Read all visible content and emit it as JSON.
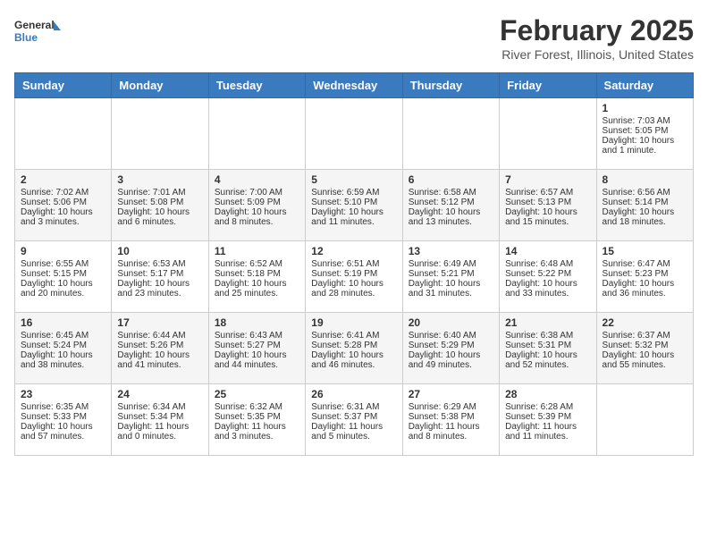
{
  "header": {
    "logo_general": "General",
    "logo_blue": "Blue",
    "month_year": "February 2025",
    "location": "River Forest, Illinois, United States"
  },
  "weekdays": [
    "Sunday",
    "Monday",
    "Tuesday",
    "Wednesday",
    "Thursday",
    "Friday",
    "Saturday"
  ],
  "weeks": [
    [
      {
        "day": "",
        "info": ""
      },
      {
        "day": "",
        "info": ""
      },
      {
        "day": "",
        "info": ""
      },
      {
        "day": "",
        "info": ""
      },
      {
        "day": "",
        "info": ""
      },
      {
        "day": "",
        "info": ""
      },
      {
        "day": "1",
        "info": "Sunrise: 7:03 AM\nSunset: 5:05 PM\nDaylight: 10 hours and 1 minute."
      }
    ],
    [
      {
        "day": "2",
        "info": "Sunrise: 7:02 AM\nSunset: 5:06 PM\nDaylight: 10 hours and 3 minutes."
      },
      {
        "day": "3",
        "info": "Sunrise: 7:01 AM\nSunset: 5:08 PM\nDaylight: 10 hours and 6 minutes."
      },
      {
        "day": "4",
        "info": "Sunrise: 7:00 AM\nSunset: 5:09 PM\nDaylight: 10 hours and 8 minutes."
      },
      {
        "day": "5",
        "info": "Sunrise: 6:59 AM\nSunset: 5:10 PM\nDaylight: 10 hours and 11 minutes."
      },
      {
        "day": "6",
        "info": "Sunrise: 6:58 AM\nSunset: 5:12 PM\nDaylight: 10 hours and 13 minutes."
      },
      {
        "day": "7",
        "info": "Sunrise: 6:57 AM\nSunset: 5:13 PM\nDaylight: 10 hours and 15 minutes."
      },
      {
        "day": "8",
        "info": "Sunrise: 6:56 AM\nSunset: 5:14 PM\nDaylight: 10 hours and 18 minutes."
      }
    ],
    [
      {
        "day": "9",
        "info": "Sunrise: 6:55 AM\nSunset: 5:15 PM\nDaylight: 10 hours and 20 minutes."
      },
      {
        "day": "10",
        "info": "Sunrise: 6:53 AM\nSunset: 5:17 PM\nDaylight: 10 hours and 23 minutes."
      },
      {
        "day": "11",
        "info": "Sunrise: 6:52 AM\nSunset: 5:18 PM\nDaylight: 10 hours and 25 minutes."
      },
      {
        "day": "12",
        "info": "Sunrise: 6:51 AM\nSunset: 5:19 PM\nDaylight: 10 hours and 28 minutes."
      },
      {
        "day": "13",
        "info": "Sunrise: 6:49 AM\nSunset: 5:21 PM\nDaylight: 10 hours and 31 minutes."
      },
      {
        "day": "14",
        "info": "Sunrise: 6:48 AM\nSunset: 5:22 PM\nDaylight: 10 hours and 33 minutes."
      },
      {
        "day": "15",
        "info": "Sunrise: 6:47 AM\nSunset: 5:23 PM\nDaylight: 10 hours and 36 minutes."
      }
    ],
    [
      {
        "day": "16",
        "info": "Sunrise: 6:45 AM\nSunset: 5:24 PM\nDaylight: 10 hours and 38 minutes."
      },
      {
        "day": "17",
        "info": "Sunrise: 6:44 AM\nSunset: 5:26 PM\nDaylight: 10 hours and 41 minutes."
      },
      {
        "day": "18",
        "info": "Sunrise: 6:43 AM\nSunset: 5:27 PM\nDaylight: 10 hours and 44 minutes."
      },
      {
        "day": "19",
        "info": "Sunrise: 6:41 AM\nSunset: 5:28 PM\nDaylight: 10 hours and 46 minutes."
      },
      {
        "day": "20",
        "info": "Sunrise: 6:40 AM\nSunset: 5:29 PM\nDaylight: 10 hours and 49 minutes."
      },
      {
        "day": "21",
        "info": "Sunrise: 6:38 AM\nSunset: 5:31 PM\nDaylight: 10 hours and 52 minutes."
      },
      {
        "day": "22",
        "info": "Sunrise: 6:37 AM\nSunset: 5:32 PM\nDaylight: 10 hours and 55 minutes."
      }
    ],
    [
      {
        "day": "23",
        "info": "Sunrise: 6:35 AM\nSunset: 5:33 PM\nDaylight: 10 hours and 57 minutes."
      },
      {
        "day": "24",
        "info": "Sunrise: 6:34 AM\nSunset: 5:34 PM\nDaylight: 11 hours and 0 minutes."
      },
      {
        "day": "25",
        "info": "Sunrise: 6:32 AM\nSunset: 5:35 PM\nDaylight: 11 hours and 3 minutes."
      },
      {
        "day": "26",
        "info": "Sunrise: 6:31 AM\nSunset: 5:37 PM\nDaylight: 11 hours and 5 minutes."
      },
      {
        "day": "27",
        "info": "Sunrise: 6:29 AM\nSunset: 5:38 PM\nDaylight: 11 hours and 8 minutes."
      },
      {
        "day": "28",
        "info": "Sunrise: 6:28 AM\nSunset: 5:39 PM\nDaylight: 11 hours and 11 minutes."
      },
      {
        "day": "",
        "info": ""
      }
    ]
  ]
}
